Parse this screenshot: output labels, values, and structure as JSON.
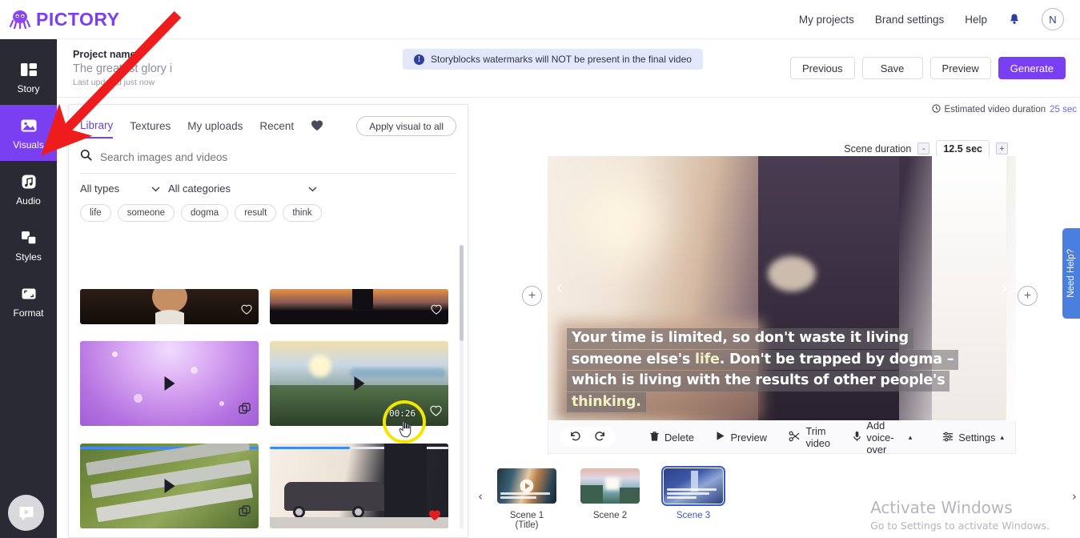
{
  "app": {
    "brand": "PICTORY",
    "brand_color": "#7b3ff2"
  },
  "topnav": {
    "items": [
      {
        "label": "My projects"
      },
      {
        "label": "Brand settings"
      },
      {
        "label": "Help"
      }
    ],
    "notification_icon": "bell-icon",
    "avatar_initial": "N"
  },
  "project": {
    "label": "Project name",
    "name": "The greatest glory i",
    "updated": "Last updated just now"
  },
  "notice": {
    "icon": "info-icon",
    "text": "Storyblocks watermarks will NOT be present in the final video"
  },
  "actions": {
    "previous": "Previous",
    "save": "Save",
    "preview": "Preview",
    "generate": "Generate"
  },
  "rail": {
    "items": [
      {
        "label": "Story",
        "icon": "layout-icon",
        "active": false
      },
      {
        "label": "Visuals",
        "icon": "image-icon",
        "active": true
      },
      {
        "label": "Audio",
        "icon": "music-note-icon",
        "active": false
      },
      {
        "label": "Styles",
        "icon": "layers-icon",
        "active": false
      },
      {
        "label": "Format",
        "icon": "crop-icon",
        "active": false
      }
    ],
    "chat_icon": "video-chat-icon"
  },
  "library": {
    "tabs": [
      {
        "label": "Library",
        "active": true
      },
      {
        "label": "Textures",
        "active": false
      },
      {
        "label": "My uploads",
        "active": false
      },
      {
        "label": "Recent",
        "active": false
      }
    ],
    "favorites_icon": "heart-icon",
    "apply_all": "Apply visual to all",
    "search": {
      "icon": "search-icon",
      "placeholder": "Search images and videos",
      "value": ""
    },
    "filters": [
      {
        "label": "All types",
        "icon": "chevron-down-icon"
      },
      {
        "label": "All categories",
        "icon": "chevron-down-icon"
      }
    ],
    "chips": [
      "life",
      "someone",
      "dogma",
      "result",
      "think"
    ],
    "tiles": [
      {
        "name": "tile-1",
        "kind": "image",
        "badge": "heart-icon"
      },
      {
        "name": "tile-2",
        "kind": "image",
        "badge": "heart-icon"
      },
      {
        "name": "tile-3",
        "kind": "video",
        "badge": "stack-icon"
      },
      {
        "name": "tile-4",
        "kind": "video",
        "badge": "heart-icon"
      },
      {
        "name": "tile-5",
        "kind": "video",
        "badge": "stack-icon"
      },
      {
        "name": "tile-6",
        "kind": "video",
        "badge": "heart-filled-icon"
      }
    ]
  },
  "preview": {
    "estimated_label": "Estimated video duration",
    "estimated_value": "25 sec",
    "estimated_icon": "clock-icon",
    "scene_duration_label": "Scene duration",
    "scene_duration_value": "12.5 sec",
    "decrease": "-",
    "increase": "+",
    "prev_arrow": "‹",
    "next_arrow": "›",
    "add_before": "+",
    "add_after": "+",
    "caption_lines": [
      {
        "pre": "Your time is limited, so don't waste it living",
        "hl": "",
        "post": ""
      },
      {
        "pre": "someone else's ",
        "hl": "life",
        "post": ". Don't be trapped by dogma –"
      },
      {
        "pre": "which is living with the results of other people's",
        "hl": "",
        "post": ""
      },
      {
        "pre": "",
        "hl": "thinking.",
        "post": ""
      }
    ]
  },
  "toolbar": {
    "undo": "undo-icon",
    "redo": "redo-icon",
    "items": [
      {
        "label": "Delete",
        "icon": "trash-icon"
      },
      {
        "label": "Preview",
        "icon": "play-icon"
      },
      {
        "label": "Trim video",
        "icon": "scissors-icon"
      },
      {
        "label": "Add voice-over",
        "icon": "microphone-icon",
        "caret": "▴"
      },
      {
        "label": "Settings",
        "icon": "sliders-icon",
        "caret": "▴"
      }
    ]
  },
  "scenes": {
    "left_arrow": "‹",
    "right_arrow": "›",
    "items": [
      {
        "label": "Scene 1 (Title)",
        "selected": false,
        "has_play": true
      },
      {
        "label": "Scene 2",
        "selected": false,
        "has_play": false
      },
      {
        "label": "Scene 3",
        "selected": true,
        "has_play": false
      }
    ]
  },
  "help_tab": {
    "label": "Need Help?"
  },
  "annotation": {
    "timecode": "00:26",
    "highlight_color": "#f2e500",
    "arrow_color": "#ee1c1c"
  },
  "watermark": {
    "title": "Activate Windows",
    "subtitle": "Go to Settings to activate Windows."
  }
}
